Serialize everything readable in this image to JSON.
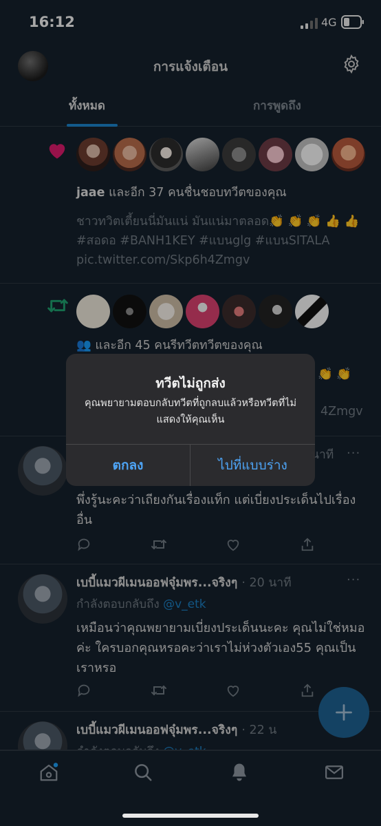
{
  "status_bar": {
    "time": "16:12",
    "network": "4G"
  },
  "header": {
    "title": "การแจ้งเตือน",
    "tabs": [
      {
        "label": "ทั้งหมด",
        "active": true
      },
      {
        "label": "การพูดถึง",
        "active": false
      }
    ]
  },
  "notifications": [
    {
      "type": "like",
      "icon": "heart-icon",
      "actor": "jaae",
      "summary_suffix": " และอีก 37 คนชื่นชอบทวีตของคุณ",
      "body": "ชาวทวิตเตี้ยนนี่มันแน่ มันแน่มาตลอด👏 👏 👏 👍 👍  #สอดอ #BANH1KEY #แบนglg #แบนSITALA pic.twitter.com/Skp6h4Zmgv",
      "avatar_count": 8
    },
    {
      "type": "retweet",
      "icon": "retweet-icon",
      "actor": "👥",
      "summary_suffix": " และอีก 45 คนรีทวีตทวีตของคุณ",
      "body_end": "👏 👏",
      "body_link_tail": "4Zmgv",
      "avatar_count": 7
    }
  ],
  "tweets": [
    {
      "time": "นาที",
      "text": "พึ่งรู้นะคะว่าเถียงกันเรื่องแท็ก แต่เบี่ยงประเด็นไปเรื่องอื่น"
    },
    {
      "name": "เบบี้แมวผีเมนออฟจุ๋มพร...จริงๆ",
      "time": "· 20 นาที",
      "reply_prefix": "กำลังตอบกลับถึง ",
      "reply_handle": "@v_etk",
      "text": "เหมือนว่าคุณพยายามเบี่ยงประเด็นนะคะ คุณไม่ใช่หมอค่ะ ใครบอกคุณหรอคะว่าเราไม่ห่วงตัวเอง55 คุณเป็นเราหรอ"
    },
    {
      "name": "เบบี้แมวผีเมนออฟจุ๋มพร...จริงๆ",
      "time": "· 22 น",
      "reply_prefix": "กำลังตอบกลับถึง ",
      "reply_handle": "@v_etk"
    }
  ],
  "alert": {
    "title": "ทวีตไม่ถูกส่ง",
    "message": "คุณพยายามตอบกลับทวีตที่ถูกลบแล้วหรือทวีตที่ไม่แสดงให้คุณเห็น",
    "ok_label": "ตกลง",
    "draft_label": "ไปที่แบบร่าง"
  },
  "more_menu": "···",
  "colors": {
    "background": "#15202b",
    "accent": "#1d9bf0",
    "like": "#f91880",
    "retweet": "#00ba7c"
  },
  "tab_bar": [
    "home-icon",
    "search-icon",
    "bell-icon",
    "mail-icon"
  ]
}
